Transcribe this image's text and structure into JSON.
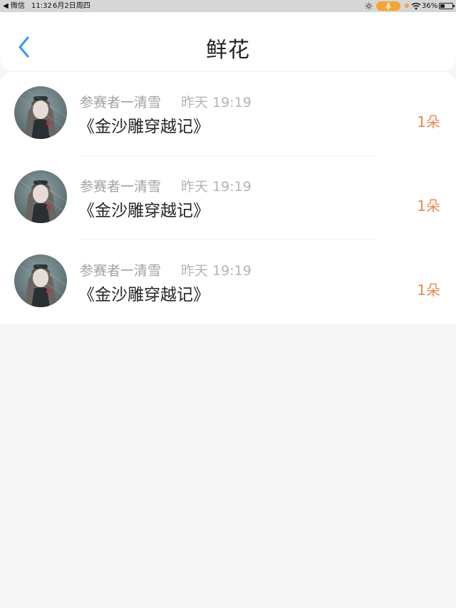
{
  "status_bar": {
    "back_app": "◀ 微信",
    "time": "11:32",
    "date": "6月2日周四",
    "battery": "36%"
  },
  "nav": {
    "title": "鲜花"
  },
  "records": [
    {
      "user": "参赛者一清雪",
      "time": "昨天 19:19",
      "work": "《金沙雕穿越记》",
      "count": "1朵"
    },
    {
      "user": "参赛者一清雪",
      "time": "昨天 19:19",
      "work": "《金沙雕穿越记》",
      "count": "1朵"
    },
    {
      "user": "参赛者一清雪",
      "time": "昨天 19:19",
      "work": "《金沙雕穿越记》",
      "count": "1朵"
    }
  ],
  "colors": {
    "accent_blue": "#3a9bf0",
    "count_orange": "#ea8a4b",
    "mic_pill": "#f4a433"
  }
}
